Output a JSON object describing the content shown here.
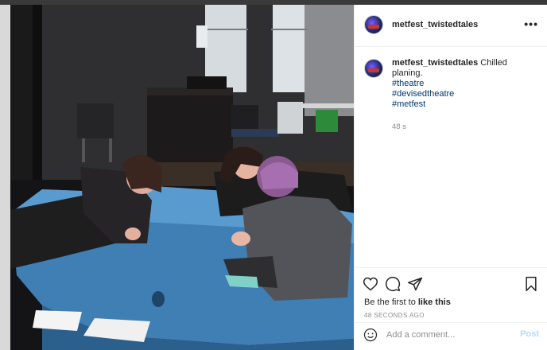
{
  "post": {
    "username": "metfest_twistedtales",
    "more_icon": "more-horizontal-icon",
    "caption": {
      "username": "metfest_twistedtales",
      "text": "Chilled planing.",
      "hashtags": [
        "#theatre",
        "#devisedtheatre",
        "#metfest"
      ],
      "age": "48 s"
    },
    "actions": {
      "icons": [
        "heart-icon",
        "comment-icon",
        "share-icon",
        "bookmark-icon"
      ],
      "likes_prefix": "Be the first to ",
      "likes_bold": "like this",
      "timestamp": "48 SECONDS AGO"
    },
    "comment_box": {
      "placeholder": "Add a comment...",
      "post_label": "Post",
      "emoji_icon": "smile-icon"
    }
  },
  "colors": {
    "text": "#262626",
    "secondary": "#8e8e8e",
    "hashtag": "#00376b",
    "post_disabled": "#b3dbff"
  }
}
